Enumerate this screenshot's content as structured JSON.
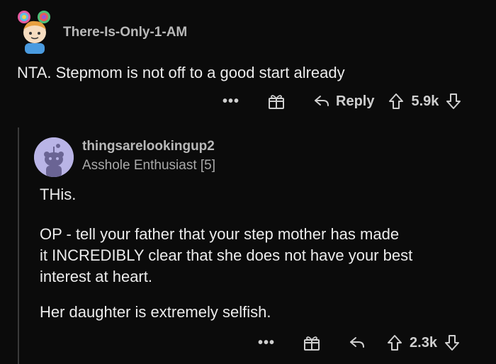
{
  "comment1": {
    "username": "There-Is-Only-1-AM",
    "body": "NTA. Stepmom is not off to a good start already",
    "actions": {
      "more": "•••",
      "reply_label": "Reply",
      "score": "5.9k"
    }
  },
  "comment2": {
    "username": "thingsarelookingup2",
    "flair": "Asshole Enthusiast [5]",
    "paragraphs": [
      "THis.",
      "OP - tell your father that your step mother has made",
      "it INCREDIBLY clear that she does not have your best",
      "interest at heart.",
      "Her daughter is extremely selfish."
    ],
    "actions": {
      "more": "•••",
      "score": "2.3k"
    }
  },
  "colors": {
    "background": "#0b0b0b",
    "text": "#ececec",
    "muted": "#b9b9b9",
    "avatar2_bg": "#b9b4e6"
  }
}
